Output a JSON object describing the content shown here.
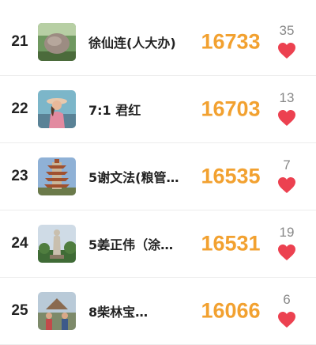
{
  "rows": [
    {
      "rank": "21",
      "name": "徐仙连(人大办)",
      "score": "16733",
      "likes": "35",
      "avatar_icon": "stone-monument-photo"
    },
    {
      "rank": "22",
      "name": "7:1 君红",
      "score": "16703",
      "likes": "13",
      "avatar_icon": "woman-with-hat-photo"
    },
    {
      "rank": "23",
      "name": "5谢文法(粮管…",
      "score": "16535",
      "likes": "7",
      "avatar_icon": "pagoda-photo"
    },
    {
      "rank": "24",
      "name": "5姜正伟（涂…",
      "score": "16531",
      "likes": "19",
      "avatar_icon": "buddha-statue-photo"
    },
    {
      "rank": "25",
      "name": "8柴林宝…",
      "score": "16066",
      "likes": "6",
      "avatar_icon": "group-photo"
    }
  ],
  "colors": {
    "score": "#f2a130",
    "heart": "#ec4150",
    "rank": "#222222"
  }
}
